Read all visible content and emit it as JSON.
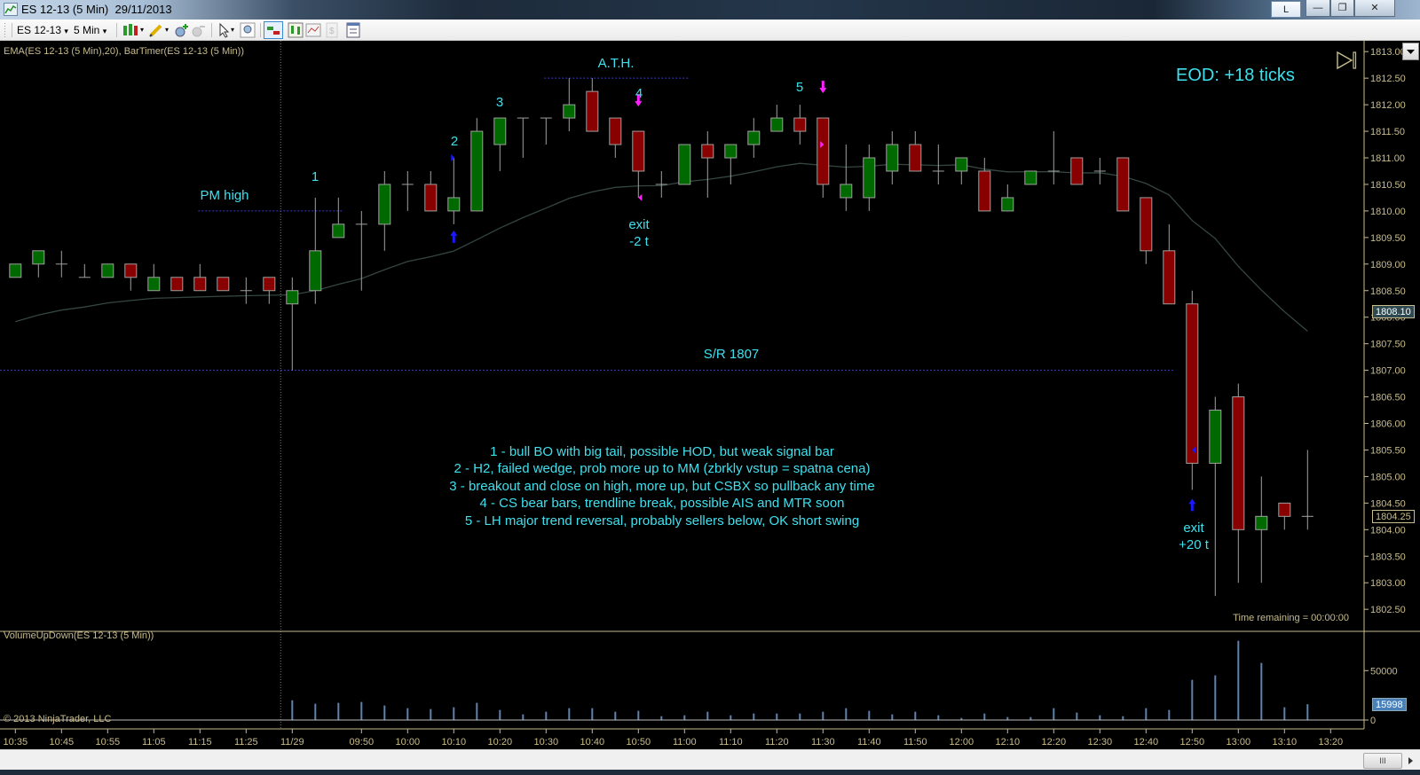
{
  "window": {
    "title": "ES 12-13 (5 Min)  29/11/2013",
    "link_button": "L",
    "minimize": "—",
    "restore": "❐",
    "close": "✕"
  },
  "toolbar": {
    "instrument": "ES 12-13",
    "interval": "5 Min",
    "dropdown_glyph": "▾"
  },
  "indicator_label": "EMA(ES 12-13 (5 Min),20), BarTimer(ES 12-13 (5 Min))",
  "volume_label": "VolumeUpDown(ES 12-13 (5 Min))",
  "copyright": "© 2013 NinjaTrader, LLC",
  "time_remaining": "Time remaining = 00:00:00",
  "eod": "EOD: +18 ticks",
  "annotations": {
    "pm_high": "PM high",
    "ath": "A.T.H.",
    "sr": "S/R 1807",
    "n1": "1",
    "n2": "2",
    "n3": "3",
    "n4": "4",
    "n5": "5",
    "exit1_a": "exit",
    "exit1_b": "-2 t",
    "exit2_a": "exit",
    "exit2_b": "+20 t"
  },
  "notes": [
    "1 - bull BO with big tail, possible HOD, but weak signal bar",
    "2 - H2, failed wedge, prob more up to MM (zbrkly vstup = spatna cena)",
    "3 - breakout and close on high, more up, but CSBX so pullback any time",
    "4 - CS bear bars, trendline break, possible AIS and MTR soon",
    "5 - LH major trend reversal, probably sellers below, OK short swing"
  ],
  "colors": {
    "up": "#006a00",
    "down": "#880000",
    "wick": "#a0a0a0",
    "ema": "#34463f",
    "volume": "#5d82ad",
    "annotation": "#3fe0ee",
    "axis": "#c8bc8c",
    "level": "#3c3cd0"
  },
  "chart_data": {
    "type": "candlestick",
    "title": "ES 12-13 (5 Min)",
    "ylim": [
      1802.5,
      1813.0
    ],
    "yticks": [
      "1813.00",
      "1812.50",
      "1812.00",
      "1811.50",
      "1811.00",
      "1810.50",
      "1810.00",
      "1809.50",
      "1809.00",
      "1808.50",
      "1808.00",
      "1807.50",
      "1807.00",
      "1806.50",
      "1806.00",
      "1805.50",
      "1805.00",
      "1804.50",
      "1804.00",
      "1803.50",
      "1803.00",
      "1802.50"
    ],
    "times": [
      "10:35",
      "10:40",
      "10:45",
      "10:50",
      "10:55",
      "11:00",
      "11:05",
      "11:10",
      "11:15",
      "11:20",
      "11:25",
      "11:30",
      "09:35",
      "09:40",
      "09:45",
      "09:50",
      "09:55",
      "10:00",
      "10:05",
      "10:10",
      "10:15",
      "10:20",
      "10:25",
      "10:30",
      "10:35",
      "10:40",
      "10:45",
      "10:50",
      "10:55",
      "11:00",
      "11:05",
      "11:10",
      "11:15",
      "11:20",
      "11:25",
      "11:30",
      "11:35",
      "11:40",
      "11:45",
      "11:50",
      "11:55",
      "12:00",
      "12:05",
      "12:10",
      "12:15",
      "12:20",
      "12:25",
      "12:30",
      "12:35",
      "12:40",
      "12:45",
      "12:50",
      "12:55",
      "13:00",
      "13:05",
      "13:10",
      "13:15"
    ],
    "xtick_labels": [
      {
        "bar": 0,
        "label": "10:35"
      },
      {
        "bar": 2,
        "label": "10:45"
      },
      {
        "bar": 4,
        "label": "10:55"
      },
      {
        "bar": 6,
        "label": "11:05"
      },
      {
        "bar": 8,
        "label": "11:15"
      },
      {
        "bar": 10,
        "label": "11:25"
      },
      {
        "bar": 12,
        "label": "11/29"
      },
      {
        "bar": 15,
        "label": "09:50"
      },
      {
        "bar": 17,
        "label": "10:00"
      },
      {
        "bar": 19,
        "label": "10:10"
      },
      {
        "bar": 21,
        "label": "10:20"
      },
      {
        "bar": 23,
        "label": "10:30"
      },
      {
        "bar": 25,
        "label": "10:40"
      },
      {
        "bar": 27,
        "label": "10:50"
      },
      {
        "bar": 29,
        "label": "11:00"
      },
      {
        "bar": 31,
        "label": "11:10"
      },
      {
        "bar": 33,
        "label": "11:20"
      },
      {
        "bar": 35,
        "label": "11:30"
      },
      {
        "bar": 37,
        "label": "11:40"
      },
      {
        "bar": 39,
        "label": "11:50"
      },
      {
        "bar": 41,
        "label": "12:00"
      },
      {
        "bar": 43,
        "label": "12:10"
      },
      {
        "bar": 45,
        "label": "12:20"
      },
      {
        "bar": 47,
        "label": "12:30"
      },
      {
        "bar": 49,
        "label": "12:40"
      },
      {
        "bar": 51,
        "label": "12:50"
      },
      {
        "bar": 53,
        "label": "13:00"
      },
      {
        "bar": 55,
        "label": "13:10"
      },
      {
        "bar": 57,
        "label": "13:20"
      }
    ],
    "ohlc": [
      [
        1808.75,
        1809.0,
        1808.75,
        1809.0
      ],
      [
        1809.0,
        1809.25,
        1808.75,
        1809.25
      ],
      [
        1809.0,
        1809.25,
        1808.75,
        1809.0
      ],
      [
        1808.75,
        1809.0,
        1808.75,
        1808.75
      ],
      [
        1808.75,
        1809.0,
        1808.75,
        1809.0
      ],
      [
        1809.0,
        1809.0,
        1808.5,
        1808.75
      ],
      [
        1808.5,
        1809.0,
        1808.5,
        1808.75
      ],
      [
        1808.75,
        1808.75,
        1808.5,
        1808.5
      ],
      [
        1808.75,
        1809.0,
        1808.5,
        1808.5
      ],
      [
        1808.75,
        1808.75,
        1808.5,
        1808.5
      ],
      [
        1808.5,
        1808.75,
        1808.25,
        1808.5
      ],
      [
        1808.75,
        1808.75,
        1808.25,
        1808.5
      ],
      [
        1808.25,
        1808.75,
        1807.0,
        1808.5
      ],
      [
        1808.5,
        1810.25,
        1808.25,
        1809.25
      ],
      [
        1809.5,
        1810.25,
        1809.5,
        1809.75
      ],
      [
        1809.75,
        1810.0,
        1808.5,
        1809.75
      ],
      [
        1809.75,
        1810.75,
        1809.25,
        1810.5
      ],
      [
        1810.5,
        1810.75,
        1810.0,
        1810.5
      ],
      [
        1810.5,
        1810.75,
        1810.0,
        1810.0
      ],
      [
        1810.0,
        1811.0,
        1809.75,
        1810.25
      ],
      [
        1810.0,
        1811.75,
        1810.0,
        1811.5
      ],
      [
        1811.25,
        1811.75,
        1810.75,
        1811.75
      ],
      [
        1811.75,
        1811.75,
        1811.0,
        1811.75
      ],
      [
        1811.75,
        1811.75,
        1811.25,
        1811.75
      ],
      [
        1811.75,
        1812.5,
        1811.5,
        1812.0
      ],
      [
        1812.25,
        1812.5,
        1811.5,
        1811.5
      ],
      [
        1811.75,
        1811.75,
        1811.0,
        1811.25
      ],
      [
        1811.5,
        1811.5,
        1810.25,
        1810.75
      ],
      [
        1810.5,
        1810.75,
        1810.25,
        1810.5
      ],
      [
        1810.5,
        1811.25,
        1810.5,
        1811.25
      ],
      [
        1811.25,
        1811.5,
        1810.25,
        1811.0
      ],
      [
        1811.0,
        1811.25,
        1810.5,
        1811.25
      ],
      [
        1811.25,
        1811.75,
        1811.0,
        1811.5
      ],
      [
        1811.5,
        1812.0,
        1811.5,
        1811.75
      ],
      [
        1811.75,
        1812.0,
        1811.25,
        1811.5
      ],
      [
        1811.75,
        1811.75,
        1810.25,
        1810.5
      ],
      [
        1810.25,
        1811.25,
        1810.0,
        1810.5
      ],
      [
        1810.25,
        1811.25,
        1810.0,
        1811.0
      ],
      [
        1810.75,
        1811.5,
        1810.5,
        1811.25
      ],
      [
        1811.25,
        1811.5,
        1810.75,
        1810.75
      ],
      [
        1810.75,
        1811.25,
        1810.5,
        1810.75
      ],
      [
        1810.75,
        1811.0,
        1810.5,
        1811.0
      ],
      [
        1810.75,
        1811.0,
        1810.0,
        1810.0
      ],
      [
        1810.0,
        1810.5,
        1810.0,
        1810.25
      ],
      [
        1810.5,
        1810.75,
        1810.5,
        1810.75
      ],
      [
        1810.75,
        1811.5,
        1810.5,
        1810.75
      ],
      [
        1811.0,
        1811.0,
        1810.5,
        1810.5
      ],
      [
        1810.75,
        1811.0,
        1810.5,
        1810.75
      ],
      [
        1811.0,
        1811.0,
        1810.0,
        1810.0
      ],
      [
        1810.25,
        1810.25,
        1809.0,
        1809.25
      ],
      [
        1809.25,
        1809.75,
        1808.25,
        1808.25
      ],
      [
        1808.25,
        1808.5,
        1804.75,
        1805.25
      ],
      [
        1805.25,
        1806.5,
        1802.75,
        1806.25
      ],
      [
        1806.5,
        1806.75,
        1803.0,
        1804.0
      ],
      [
        1804.0,
        1805.0,
        1803.0,
        1804.25
      ],
      [
        1804.5,
        1804.5,
        1804.0,
        1804.25
      ],
      [
        1804.25,
        1805.5,
        1804.0,
        1804.25
      ]
    ],
    "volume": [
      null,
      null,
      null,
      null,
      null,
      null,
      null,
      null,
      null,
      null,
      null,
      null,
      20000,
      16500,
      17400,
      18300,
      14700,
      12000,
      11100,
      12900,
      17400,
      10200,
      5700,
      8400,
      12000,
      12000,
      8400,
      9300,
      3900,
      4800,
      8400,
      4800,
      6600,
      6600,
      6600,
      8400,
      12000,
      9300,
      5700,
      8400,
      4800,
      2100,
      6600,
      3000,
      3000,
      12000,
      7500,
      4800,
      3900,
      12000,
      10200,
      40700,
      45200,
      80200,
      57800,
      12900,
      15998
    ],
    "volume_ticks": [
      "50000",
      "0"
    ],
    "volume_last": "15998",
    "ema_period": 20,
    "ema_seed": 1807.8,
    "ema_last": "1808.10",
    "last_price": "1804.25",
    "levels": [
      {
        "name": "pm-high",
        "price": 1810.0,
        "from_bar": 8,
        "to_bar": 14
      },
      {
        "name": "ath",
        "price": 1812.5,
        "from_bar": 23,
        "to_bar": 29
      },
      {
        "name": "sr-1807",
        "price": 1807.0,
        "from_bar": -1,
        "to_bar": 50
      }
    ],
    "markers": [
      {
        "type": "up-arrow",
        "bar": 19,
        "price": 1809.5,
        "color": "#1a1aff"
      },
      {
        "type": "entry-tri-right",
        "bar": 19,
        "price": 1811.0,
        "color": "#1a1aff"
      },
      {
        "type": "down-arrow",
        "bar": 27,
        "price": 1812.1,
        "color": "#ff22ff"
      },
      {
        "type": "exit-tri-left",
        "bar": 27,
        "price": 1810.25,
        "color": "#ff22ff"
      },
      {
        "type": "down-arrow",
        "bar": 35,
        "price": 1812.35,
        "color": "#ff22ff"
      },
      {
        "type": "entry-tri-right",
        "bar": 35,
        "price": 1811.25,
        "color": "#ff22ff"
      },
      {
        "type": "up-arrow",
        "bar": 51,
        "price": 1804.45,
        "color": "#1a1aff"
      },
      {
        "type": "exit-tri-left",
        "bar": 51,
        "price": 1805.5,
        "color": "#1a1aff"
      }
    ]
  }
}
